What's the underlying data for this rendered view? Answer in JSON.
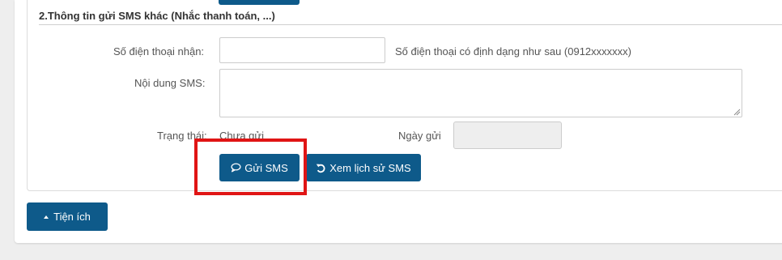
{
  "section": {
    "title": "2.Thông tin gửi SMS khác (Nhắc thanh toán, ...)"
  },
  "form": {
    "phone_label": "Số điện thoại nhận:",
    "phone_value": "",
    "phone_hint": "Số điện thoại có định dạng như sau (0912xxxxxxx)",
    "sms_label": "Nội dung SMS:",
    "sms_value": "",
    "status_label": "Trạng thái:",
    "status_value": "Chưa gửi",
    "date_label": "Ngày gửi",
    "date_value": ""
  },
  "actions": {
    "send_label": "Gửi SMS",
    "send_icon": "chat-bubble-icon",
    "history_label": "Xem lịch sử SMS",
    "history_icon": "undo-icon"
  },
  "footer": {
    "utilities_label": "Tiện ích",
    "utilities_icon": "caret-up-icon"
  },
  "colors": {
    "primary_button": "#0e5a8a",
    "highlight": "#e01515",
    "page_background": "#eeeeee",
    "disabled_input": "#eeeeee"
  }
}
